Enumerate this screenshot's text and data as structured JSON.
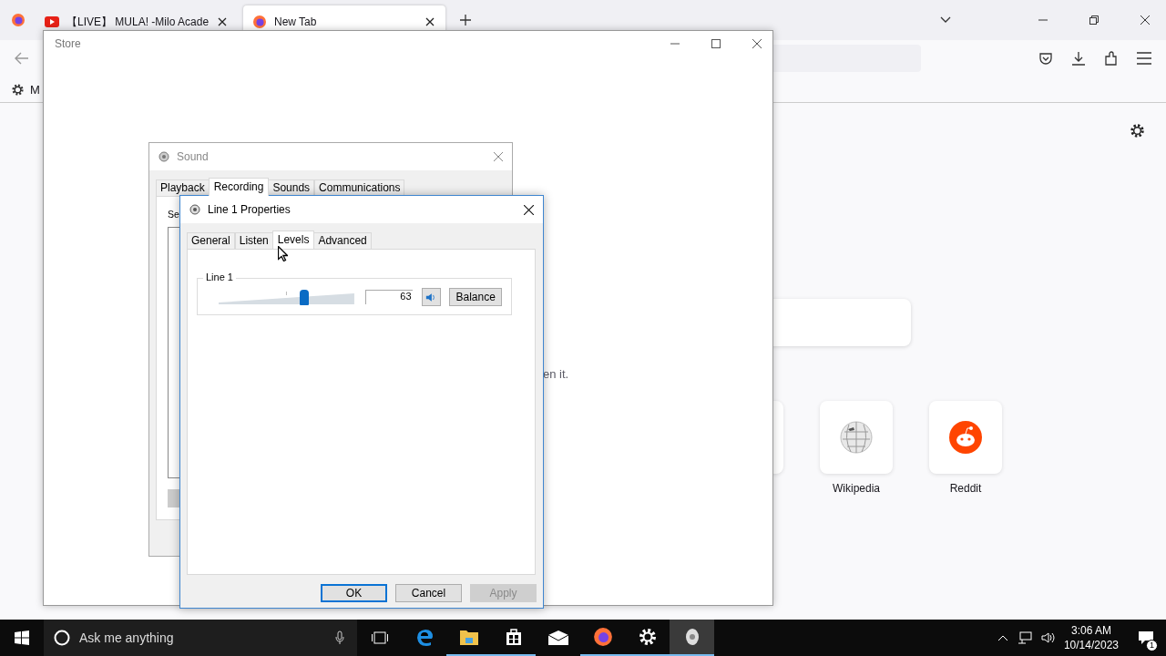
{
  "browser": {
    "tabs": [
      {
        "title": "【LIVE】 MULA! -Milo Acade",
        "kind": "video",
        "selected": false
      },
      {
        "title": "New Tab",
        "kind": "browser",
        "selected": true
      }
    ],
    "bookmark": "M",
    "hidden_text": "en it.",
    "shortcuts": [
      {
        "label": "Wikipedia",
        "kind": "wikipedia"
      },
      {
        "label": "Reddit",
        "kind": "reddit"
      }
    ]
  },
  "store_window": {
    "title": "Store"
  },
  "sound_dialog": {
    "title": "Sound",
    "tabs": [
      {
        "label": "Playback",
        "selected": false
      },
      {
        "label": "Recording",
        "selected": true
      },
      {
        "label": "Sounds",
        "selected": false
      },
      {
        "label": "Communications",
        "selected": false
      }
    ],
    "partial_label": "Se"
  },
  "properties_dialog": {
    "title": "Line 1 Properties",
    "tabs": [
      {
        "label": "General",
        "selected": false
      },
      {
        "label": "Listen",
        "selected": false
      },
      {
        "label": "Levels",
        "selected": true
      },
      {
        "label": "Advanced",
        "selected": false
      }
    ],
    "group_label": "Line 1",
    "volume": {
      "level": 0.63,
      "value": "63",
      "muted": false
    },
    "balance": "Balance",
    "buttons": [
      {
        "label": "OK",
        "default": true,
        "disabled": false
      },
      {
        "label": "Cancel",
        "default": false,
        "disabled": false
      },
      {
        "label": "Apply",
        "default": false,
        "disabled": true
      }
    ]
  },
  "taskbar": {
    "search_placeholder": "Ask me anything",
    "apps": [
      {
        "kind": "edge",
        "running": false,
        "active": false
      },
      {
        "kind": "folder",
        "running": true,
        "active": false
      },
      {
        "kind": "store",
        "running": true,
        "active": false
      },
      {
        "kind": "mail",
        "running": false,
        "active": false
      },
      {
        "kind": "firefox",
        "running": true,
        "active": false
      },
      {
        "kind": "settings",
        "running": true,
        "active": false
      },
      {
        "kind": "sound",
        "running": true,
        "active": true
      }
    ],
    "time": "3:06 AM",
    "date": "10/14/2023",
    "notifications": "1"
  }
}
